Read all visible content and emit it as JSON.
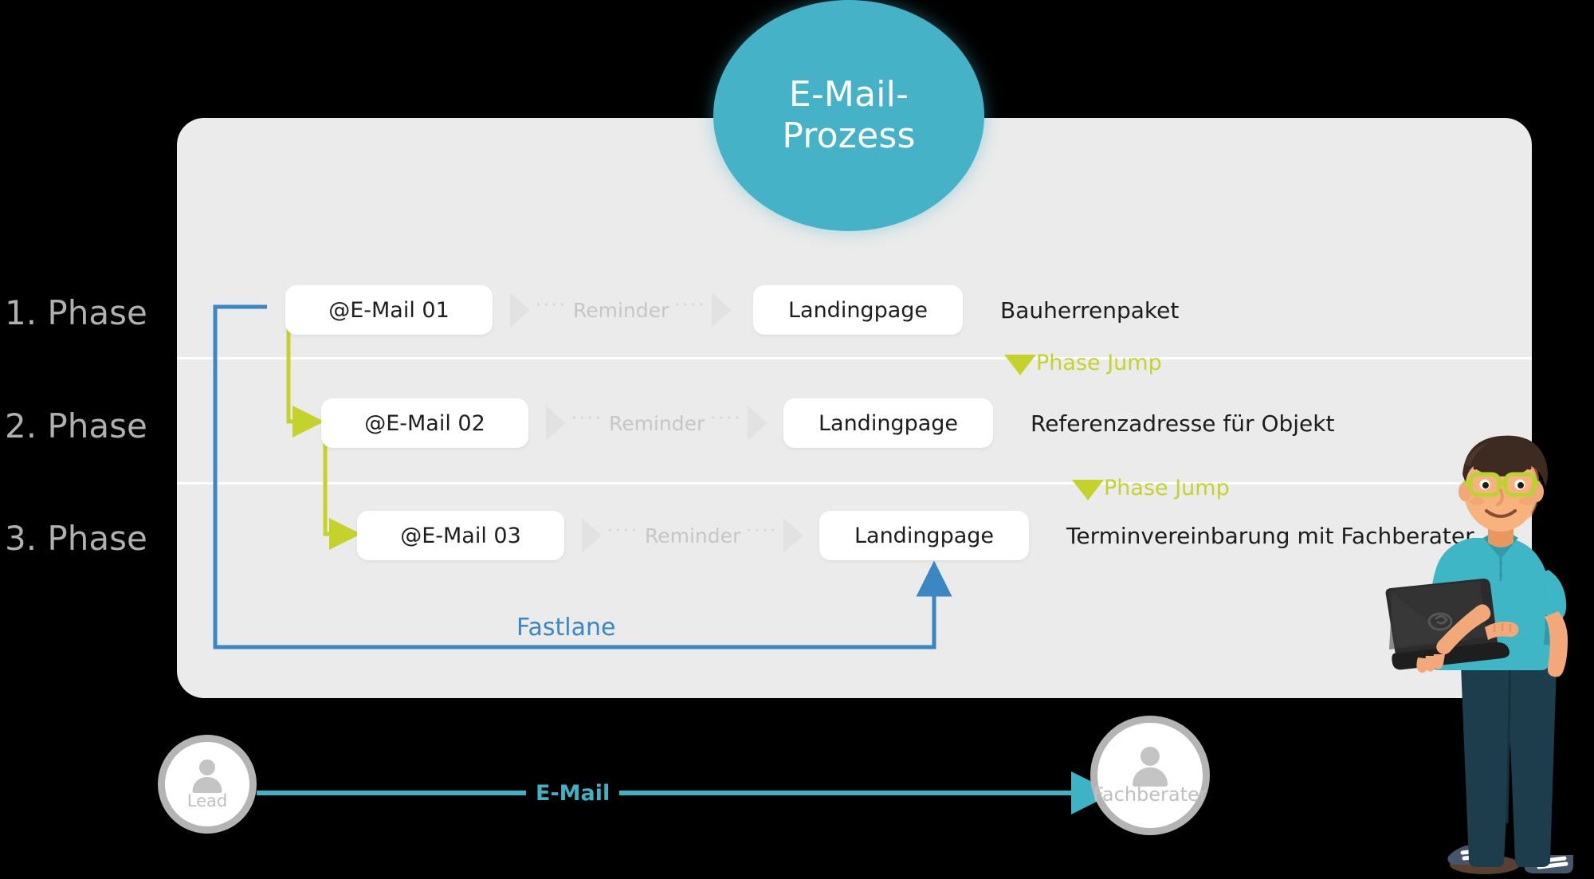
{
  "title": {
    "line1": "E-Mail-",
    "line2": "Prozess"
  },
  "colors": {
    "accent_teal": "#46b2c8",
    "panel_grey": "#ebebeb",
    "phase_jump_green": "#c6d22c",
    "fastlane_blue": "#3b87c4",
    "email_line_teal": "#3fb3c6",
    "phase_label_grey": "#b0b0b0",
    "reminder_grey": "#c6c6c6"
  },
  "phases": [
    {
      "label": "1. Phase",
      "email": "@E-Mail 01",
      "reminder": "Reminder",
      "landingpage": "Landingpage",
      "description": "Bauherrenpaket"
    },
    {
      "label": "2. Phase",
      "email": "@E-Mail 02",
      "reminder": "Reminder",
      "landingpage": "Landingpage",
      "description": "Referenzadresse für Objekt"
    },
    {
      "label": "3. Phase",
      "email": "@E-Mail 03",
      "reminder": "Reminder",
      "landingpage": "Landingpage",
      "description": "Terminvereinbarung mit Fachberater"
    }
  ],
  "phase_jumps": [
    {
      "label": "Phase Jump"
    },
    {
      "label": "Phase Jump"
    }
  ],
  "fastlane": {
    "label": "Fastlane"
  },
  "actors": {
    "left": {
      "caption": "Lead",
      "icon": "person-icon"
    },
    "right": {
      "caption": "Fachberater",
      "icon": "person-icon"
    },
    "flow_label": "E-Mail"
  },
  "dots": "····",
  "illustration": {
    "name": "man-with-laptop-illustration",
    "shirt_color": "#3fb6c6",
    "glasses_color": "#b9d430",
    "hair_color": "#3d2a20",
    "jeans_color": "#1d3d4d",
    "laptop_color": "#2b2b2b"
  }
}
